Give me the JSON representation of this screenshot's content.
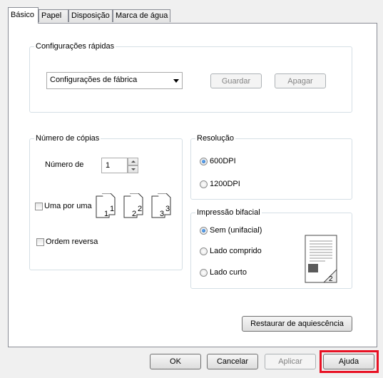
{
  "tabs": [
    "Básico",
    "Papel",
    "Disposição",
    "Marca de água"
  ],
  "quick_settings": {
    "title": "Configurações rápidas",
    "selected": "Configurações de fábrica",
    "save_label": "Guardar",
    "delete_label": "Apagar"
  },
  "copies": {
    "title": "Número de cópias",
    "count_label": "Número de",
    "count_value": "1",
    "collate_label": "Uma por uma",
    "reverse_label": "Ordem reversa"
  },
  "resolution": {
    "title": "Resolução",
    "options": [
      "600DPI",
      "1200DPI"
    ],
    "selected": "600DPI"
  },
  "duplex": {
    "title": "Impressão bifacial",
    "options": [
      "Sem (unifacial)",
      "Lado comprido",
      "Lado curto"
    ],
    "selected": "Sem (unifacial)"
  },
  "restore_defaults_label": "Restaurar de aquiescência",
  "footer": {
    "ok": "OK",
    "cancel": "Cancelar",
    "apply": "Aplicar",
    "help": "Ajuda"
  },
  "collate_pages": [
    "1",
    "1",
    "2",
    "2",
    "3",
    "3"
  ],
  "highlight_color": "#e81123"
}
